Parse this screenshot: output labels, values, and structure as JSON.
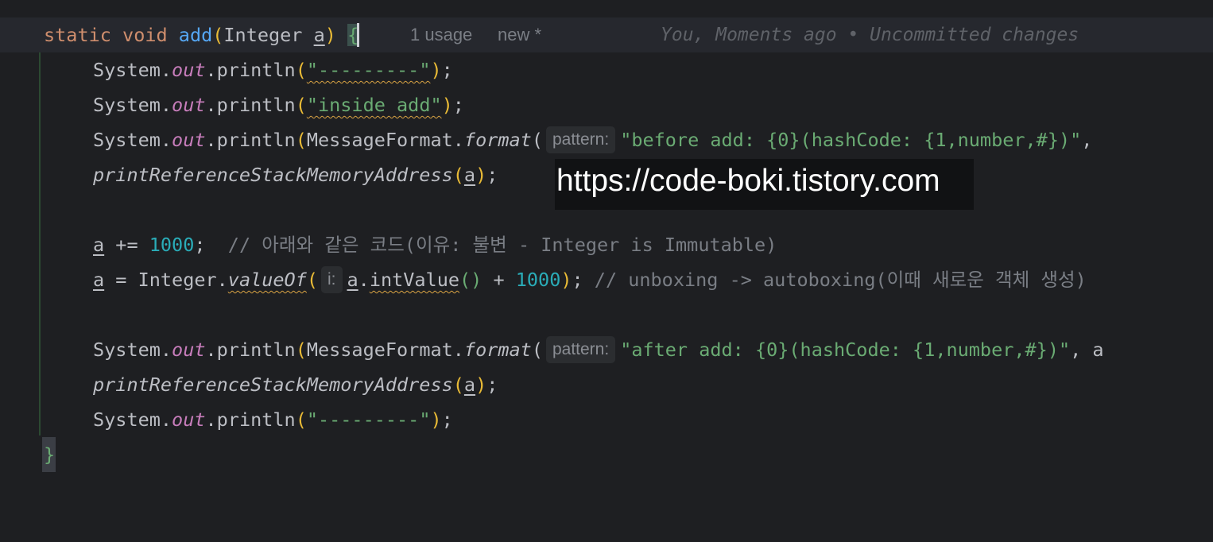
{
  "header_line": {
    "kw_static": "static",
    "kw_void": "void",
    "method_name": "add",
    "open_paren": "(",
    "param_type": "Integer",
    "param_name": "a",
    "close_paren": ")",
    "open_brace": "{",
    "usage_hint": "1 usage",
    "new_hint": "new *",
    "blame": "You, Moments ago • Uncommitted changes"
  },
  "lines": {
    "l2": {
      "p1": "System.",
      "field": "out",
      "p2": ".println",
      "paren_open": "(",
      "str": "\"---------\"",
      "paren_close": ")",
      "end": ";"
    },
    "l3": {
      "p1": "System.",
      "field": "out",
      "p2": ".println",
      "paren_open": "(",
      "str": "\"inside add\"",
      "paren_close": ")",
      "end": ";"
    },
    "l4": {
      "p1": "System.",
      "field": "out",
      "p2": ".println",
      "paren_open": "(",
      "p3": "MessageFormat.",
      "method": "format",
      "paren_open2": "(",
      "hint": "pattern:",
      "str": "\"before add: {0}(hashCode: {1,number,#})\"",
      "tail": ","
    },
    "l5": {
      "method": "printReferenceStackMemoryAddress",
      "paren_open": "(",
      "arg": "a",
      "paren_close": ")",
      "end": ";"
    },
    "l7": {
      "var": "a",
      "op": " += ",
      "num": "1000",
      "end": ";  ",
      "comment": "// 아래와 같은 코드(이유: 불변 - Integer is Immutable)"
    },
    "l8": {
      "var": "a",
      "op": " = Integer.",
      "method": "valueOf",
      "paren_open": "(",
      "hint": "i:",
      "arg": "a",
      "dot": ".",
      "method2": "intValue",
      "call_parens": "()",
      "plus": " + ",
      "num": "1000",
      "paren_close": ")",
      "end": "; ",
      "comment": "// unboxing -> autoboxing(이때 새로운 객체 생성)"
    },
    "l10": {
      "p1": "System.",
      "field": "out",
      "p2": ".println",
      "paren_open": "(",
      "p3": "MessageFormat.",
      "method": "format",
      "paren_open2": "(",
      "hint": "pattern:",
      "str": "\"after add: {0}(hashCode: {1,number,#})\"",
      "tail": ", a"
    },
    "l11": {
      "method": "printReferenceStackMemoryAddress",
      "paren_open": "(",
      "arg": "a",
      "paren_close": ")",
      "end": ";"
    },
    "l12": {
      "p1": "System.",
      "field": "out",
      "p2": ".println",
      "paren_open": "(",
      "str": "\"---------\"",
      "paren_close": ")",
      "end": ";"
    },
    "l13": {
      "close_brace": "}"
    }
  },
  "watermark": "https://code-boki.tistory.com"
}
